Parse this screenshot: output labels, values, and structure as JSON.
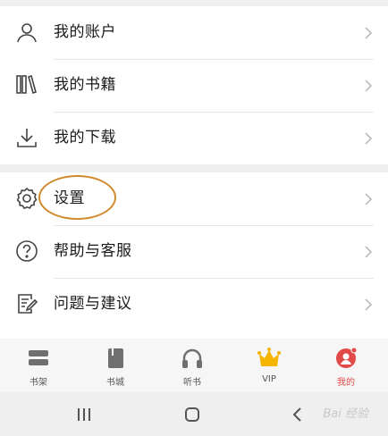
{
  "menu_group_1": [
    {
      "label": "我的账户",
      "icon": "user-icon"
    },
    {
      "label": "我的书籍",
      "icon": "books-icon"
    },
    {
      "label": "我的下载",
      "icon": "download-icon"
    }
  ],
  "menu_group_2": [
    {
      "label": "设置",
      "icon": "gear-icon"
    },
    {
      "label": "帮助与客服",
      "icon": "help-icon"
    },
    {
      "label": "问题与建议",
      "icon": "feedback-icon"
    }
  ],
  "tabbar": {
    "items": [
      {
        "label": "书架",
        "icon": "bookshelf-icon"
      },
      {
        "label": "书城",
        "icon": "bookstore-icon"
      },
      {
        "label": "听书",
        "icon": "headphones-icon"
      },
      {
        "label": "VIP",
        "icon": "crown-icon"
      },
      {
        "label": "我的",
        "icon": "profile-icon"
      }
    ],
    "active_index": 4
  },
  "navbar": {
    "icons": [
      "recents-icon",
      "home-icon",
      "back-icon"
    ]
  },
  "watermark": "Bai 经验",
  "colors": {
    "accent": "#e24a4a",
    "highlight_ring": "#d18a2c",
    "crown": "#f5b400"
  }
}
